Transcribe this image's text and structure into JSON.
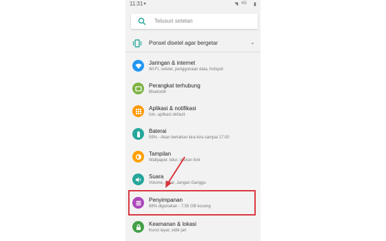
{
  "status_bar": {
    "time": "11:31",
    "network": "4G"
  },
  "search": {
    "placeholder": "Telusuri setelan"
  },
  "banner": {
    "text": "Ponsel disetel agar bergetar",
    "expand_icon": "chevron-down-icon"
  },
  "settings": [
    {
      "title": "Jaringan & internet",
      "subtitle": "Wi-Fi, seluler, penggunaan data, hotspot",
      "icon": "wifi-icon",
      "color": "#2196f3"
    },
    {
      "title": "Perangkat terhubung",
      "subtitle": "Bluetooth",
      "icon": "devices-icon",
      "color": "#7cb342"
    },
    {
      "title": "Aplikasi & notifikasi",
      "subtitle": "Izin, aplikasi default",
      "icon": "apps-icon",
      "color": "#ff9800"
    },
    {
      "title": "Baterai",
      "subtitle": "59% - Akan bertahan kira-kira sampai 17.00",
      "icon": "battery-icon",
      "color": "#26a69a"
    },
    {
      "title": "Tampilan",
      "subtitle": "Wallpaper, tidur, ukuran font",
      "icon": "display-icon",
      "color": "#ffa000"
    },
    {
      "title": "Suara",
      "subtitle": "Volume, getar, Jangan Ganggu",
      "icon": "sound-icon",
      "color": "#26a69a"
    },
    {
      "title": "Penyimpanan",
      "subtitle": "88% digunakan - 7,55 GB kosong",
      "icon": "storage-icon",
      "color": "#ab47bc"
    },
    {
      "title": "Keamanan & lokasi",
      "subtitle": "Kunci layar, sidik jari",
      "icon": "lock-icon",
      "color": "#43a047"
    }
  ],
  "annotation": {
    "highlight_color": "#d9363e"
  }
}
